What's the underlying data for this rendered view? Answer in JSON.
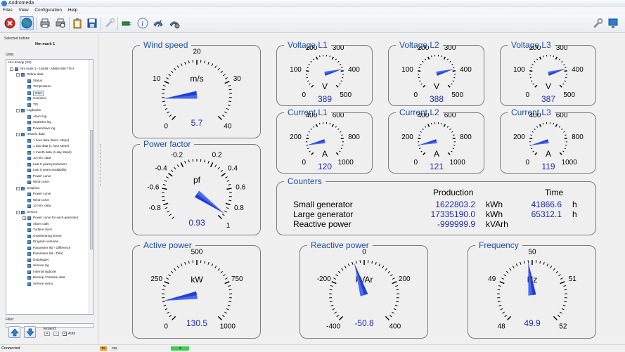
{
  "app": {
    "title": "Andromeda"
  },
  "menu": [
    "Files",
    "View",
    "Configuration",
    "Help"
  ],
  "toolbar": {
    "left_icons": [
      "stop-icon",
      "globe-icon",
      "print-icon",
      "print-preview-icon",
      "clipboard-icon",
      "save-icon",
      "tools-icon",
      "plug-icon",
      "info-icon",
      "phone-icon",
      "phone-settings-icon"
    ],
    "right_icons": [
      "wrench-icon",
      "monitor-icon"
    ]
  },
  "left": {
    "selected_label": "Selected turbine",
    "turbine_name": "Nm mark 1",
    "units_label": "Units",
    "filter_label": "Filter:",
    "expand_label": "Expand:",
    "plus": "+",
    "minus": "-",
    "auto_label": "Auto",
    "tree": [
      {
        "label": "ISA-Energi (SS)",
        "level": 0,
        "exp": "",
        "icon": false
      },
      {
        "label": "Nm mark 1 - 15546 - NM52-900 TOI-I",
        "level": 1,
        "exp": "-",
        "icon": true
      },
      {
        "label": "Online data",
        "level": 2,
        "exp": "-",
        "icon": true
      },
      {
        "label": "Status",
        "level": 3,
        "exp": "",
        "icon": true
      },
      {
        "label": "Temperature",
        "level": 3,
        "exp": "",
        "icon": true
      },
      {
        "label": "Grid",
        "level": 3,
        "exp": "",
        "icon": true,
        "selected": true
      },
      {
        "label": "Counters",
        "level": 3,
        "exp": "",
        "icon": true
      },
      {
        "label": "TOI",
        "level": 3,
        "exp": "",
        "icon": true
      },
      {
        "label": "Logbooks",
        "level": 2,
        "exp": "-",
        "icon": true
      },
      {
        "label": "Alarm log",
        "level": 3,
        "exp": "",
        "icon": true
      },
      {
        "label": "Statistics log",
        "level": 3,
        "exp": "",
        "icon": true
      },
      {
        "label": "Powerdown log",
        "level": 3,
        "exp": "",
        "icon": true
      },
      {
        "label": "Historic data",
        "level": 2,
        "exp": "-",
        "icon": true
      },
      {
        "label": "1 hour data (5min. steps)",
        "level": 3,
        "exp": "",
        "icon": true
      },
      {
        "label": "1 day data (1 hour steps)",
        "level": 3,
        "exp": "",
        "icon": true
      },
      {
        "label": "1 month data (1 day steps)",
        "level": 3,
        "exp": "",
        "icon": true
      },
      {
        "label": "10 min. data",
        "level": 3,
        "exp": "",
        "icon": true
      },
      {
        "label": "Last 5 years production",
        "level": 3,
        "exp": "",
        "icon": true
      },
      {
        "label": "Last 5 years availability",
        "level": 3,
        "exp": "",
        "icon": true
      },
      {
        "label": "Power curve",
        "level": 3,
        "exp": "",
        "icon": true
      },
      {
        "label": "Wind curve",
        "level": 3,
        "exp": "",
        "icon": true
      },
      {
        "label": "Graphics",
        "level": 2,
        "exp": "-",
        "icon": true
      },
      {
        "label": "Power curve",
        "level": 3,
        "exp": "",
        "icon": true
      },
      {
        "label": "Wind curve",
        "level": 3,
        "exp": "",
        "icon": true
      },
      {
        "label": "10 min. data",
        "level": 3,
        "exp": "",
        "icon": true
      },
      {
        "label": "Service",
        "level": 2,
        "exp": "-",
        "icon": true
      },
      {
        "label": "Power curve for each generator",
        "level": 3,
        "exp": "+",
        "icon": true
      },
      {
        "label": "Alarm calls",
        "level": 3,
        "exp": "",
        "icon": true
      },
      {
        "label": "Turbine clock",
        "level": 3,
        "exp": "",
        "icon": true
      },
      {
        "label": "Gear/bearing timers",
        "level": 3,
        "exp": "",
        "icon": true
      },
      {
        "label": "Program versions",
        "level": 3,
        "exp": "",
        "icon": true
      },
      {
        "label": "Parameter list - Difference",
        "level": 3,
        "exp": "",
        "icon": true
      },
      {
        "label": "Parameter list - Total",
        "level": 3,
        "exp": "",
        "icon": true
      },
      {
        "label": "Datalogger",
        "level": 3,
        "exp": "",
        "icon": true
      },
      {
        "label": "Service log",
        "level": 3,
        "exp": "",
        "icon": true
      },
      {
        "label": "Internal logbook",
        "level": 3,
        "exp": "",
        "icon": true
      },
      {
        "label": "Backup / Restore data",
        "level": 3,
        "exp": "",
        "icon": true
      },
      {
        "label": "Service menu",
        "level": 3,
        "exp": "",
        "icon": true
      }
    ]
  },
  "status": {
    "text": "Connected",
    "tx": "TX",
    "rx": "RX",
    "link": "3"
  },
  "gauges": [
    {
      "id": "wind",
      "title": "Wind speed",
      "unit": "m/s",
      "value": 5.7,
      "value_text": "5.7",
      "min": 0,
      "max": 40,
      "ticks": [
        {
          "v": 0,
          "t": "0"
        },
        {
          "v": 10,
          "t": "10"
        },
        {
          "v": 20,
          "t": "20"
        },
        {
          "v": 30,
          "t": "30"
        },
        {
          "v": 40,
          "t": "40"
        }
      ],
      "minor": 40,
      "unit_pos": "mid"
    },
    {
      "id": "pf",
      "title": "Power factor",
      "unit": "pf",
      "value": 0.93,
      "value_text": "0.93",
      "min": -1,
      "max": 1,
      "ticks": [
        {
          "v": -0.4,
          "t": "-0.4"
        },
        {
          "v": -0.2,
          "t": "-0.2"
        },
        {
          "v": -0.6,
          "t": "-0.6"
        },
        {
          "v": -0.8,
          "t": "-0.8"
        },
        {
          "v": 1,
          "t": "1"
        },
        {
          "v": 0.8,
          "t": "0.8"
        },
        {
          "v": 0.6,
          "t": "0.6"
        },
        {
          "v": 0.4,
          "t": "0.4"
        },
        {
          "v": 0.2,
          "t": "0.2"
        }
      ],
      "minor": 40,
      "unit_pos": "mid"
    },
    {
      "id": "v1",
      "title": "Voltage L1",
      "unit": "V",
      "value": 389,
      "value_text": "389",
      "min": 0,
      "max": 500,
      "ticks": [
        {
          "v": 0,
          "t": "0"
        },
        {
          "v": 100,
          "t": "100"
        },
        {
          "v": 200,
          "t": "200"
        },
        {
          "v": 300,
          "t": "300"
        },
        {
          "v": 400,
          "t": "400"
        },
        {
          "v": 500,
          "t": "500"
        }
      ],
      "minor": 25,
      "unit_pos": "low"
    },
    {
      "id": "v2",
      "title": "Voltage L2",
      "unit": "V",
      "value": 388,
      "value_text": "388",
      "min": 0,
      "max": 500,
      "ticks": [
        {
          "v": 0,
          "t": "0"
        },
        {
          "v": 100,
          "t": "100"
        },
        {
          "v": 200,
          "t": "200"
        },
        {
          "v": 300,
          "t": "300"
        },
        {
          "v": 400,
          "t": "400"
        },
        {
          "v": 500,
          "t": "500"
        }
      ],
      "minor": 25,
      "unit_pos": "low"
    },
    {
      "id": "v3",
      "title": "Voltage L3",
      "unit": "V",
      "value": 387,
      "value_text": "387",
      "min": 0,
      "max": 500,
      "ticks": [
        {
          "v": 0,
          "t": "0"
        },
        {
          "v": 100,
          "t": "100"
        },
        {
          "v": 200,
          "t": "200"
        },
        {
          "v": 300,
          "t": "300"
        },
        {
          "v": 400,
          "t": "400"
        },
        {
          "v": 500,
          "t": "500"
        }
      ],
      "minor": 25,
      "unit_pos": "low"
    },
    {
      "id": "c1",
      "title": "Current L1",
      "unit": "A",
      "value": 120,
      "value_text": "120",
      "min": 0,
      "max": 1000,
      "ticks": [
        {
          "v": 0,
          "t": "0"
        },
        {
          "v": 200,
          "t": "200"
        },
        {
          "v": 400,
          "t": "400"
        },
        {
          "v": 600,
          "t": "600"
        },
        {
          "v": 800,
          "t": "800"
        },
        {
          "v": 1000,
          "t": "1000"
        }
      ],
      "minor": 25,
      "unit_pos": "low"
    },
    {
      "id": "c2",
      "title": "Current L2",
      "unit": "A",
      "value": 121,
      "value_text": "121",
      "min": 0,
      "max": 1000,
      "ticks": [
        {
          "v": 0,
          "t": "0"
        },
        {
          "v": 200,
          "t": "200"
        },
        {
          "v": 400,
          "t": "400"
        },
        {
          "v": 600,
          "t": "600"
        },
        {
          "v": 800,
          "t": "800"
        },
        {
          "v": 1000,
          "t": "1000"
        }
      ],
      "minor": 25,
      "unit_pos": "low"
    },
    {
      "id": "c3",
      "title": "Current L3",
      "unit": "A",
      "value": 119,
      "value_text": "119",
      "min": 0,
      "max": 1000,
      "ticks": [
        {
          "v": 0,
          "t": "0"
        },
        {
          "v": 200,
          "t": "200"
        },
        {
          "v": 400,
          "t": "400"
        },
        {
          "v": 600,
          "t": "600"
        },
        {
          "v": 800,
          "t": "800"
        },
        {
          "v": 1000,
          "t": "1000"
        }
      ],
      "minor": 25,
      "unit_pos": "low"
    },
    {
      "id": "ap",
      "title": "Active power",
      "unit": "kW",
      "value": 130.5,
      "value_text": "130.5",
      "min": 0,
      "max": 1000,
      "ticks": [
        {
          "v": 0,
          "t": "0"
        },
        {
          "v": 250,
          "t": "250"
        },
        {
          "v": 500,
          "t": "500"
        },
        {
          "v": 750,
          "t": "750"
        },
        {
          "v": 1000,
          "t": "1000"
        }
      ],
      "minor": 40,
      "unit_pos": "mid"
    },
    {
      "id": "rp",
      "title": "Reactive power",
      "unit": "kVAr",
      "value": -50.8,
      "value_text": "-50.8",
      "min": -400,
      "max": 400,
      "ticks": [
        {
          "v": -400,
          "t": "-400"
        },
        {
          "v": -200,
          "t": "-200"
        },
        {
          "v": 0,
          "t": "0"
        },
        {
          "v": 200,
          "t": "200"
        },
        {
          "v": 400,
          "t": "400"
        }
      ],
      "minor": 40,
      "unit_pos": "mid"
    },
    {
      "id": "fr",
      "title": "Frequency",
      "unit": "Hz",
      "value": 49.9,
      "value_text": "49.9",
      "min": 48,
      "max": 52,
      "ticks": [
        {
          "v": 48,
          "t": "48"
        },
        {
          "v": 49,
          "t": "49"
        },
        {
          "v": 50,
          "t": "50"
        },
        {
          "v": 51,
          "t": "51"
        },
        {
          "v": 52,
          "t": "52"
        }
      ],
      "minor": 40,
      "unit_pos": "mid"
    }
  ],
  "counters": {
    "title": "Counters",
    "production_header": "Production",
    "time_header": "Time",
    "rows": [
      {
        "label": "Small generator",
        "production": "1622803.2",
        "prod_unit": "kWh",
        "time": "41866.6",
        "time_unit": "h"
      },
      {
        "label": "Large generator",
        "production": "17335190.0",
        "prod_unit": "kWh",
        "time": "65312.1",
        "time_unit": "h"
      },
      {
        "label": "Reactive power",
        "production": "-999999.9",
        "prod_unit": "kVArh",
        "time": "",
        "time_unit": ""
      }
    ]
  },
  "colors": {
    "needle": "#1f3fd6",
    "accent": "#1d4fa8",
    "value": "#1d2bb0"
  }
}
